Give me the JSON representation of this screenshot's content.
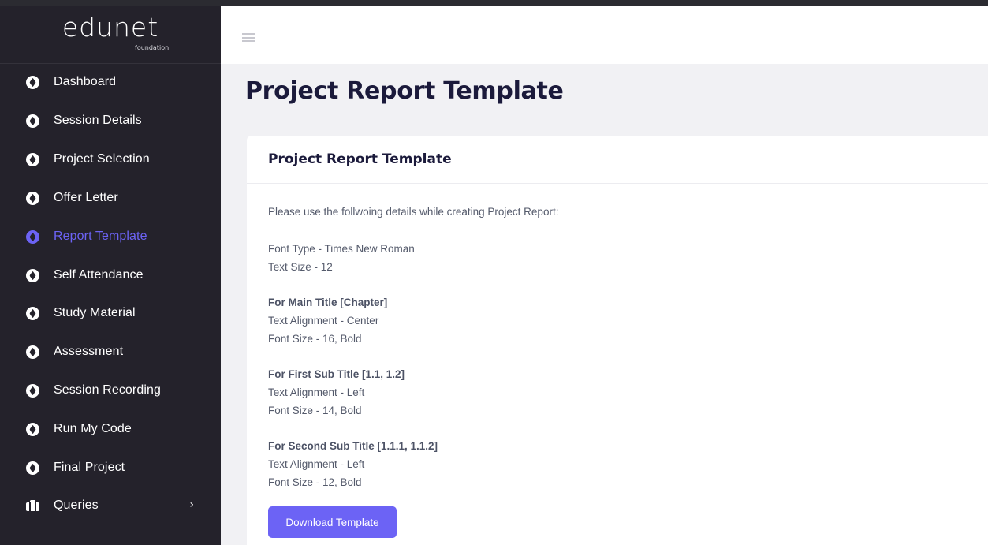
{
  "brand": {
    "name": "edunet",
    "sub": "foundation"
  },
  "sidebar": {
    "items": [
      {
        "label": "Dashboard",
        "icon": "compass-icon",
        "active": false
      },
      {
        "label": "Session Details",
        "icon": "compass-icon",
        "active": false
      },
      {
        "label": "Project Selection",
        "icon": "compass-icon",
        "active": false
      },
      {
        "label": "Offer Letter",
        "icon": "compass-icon",
        "active": false
      },
      {
        "label": "Report Template",
        "icon": "compass-icon",
        "active": true
      },
      {
        "label": "Self Attendance",
        "icon": "compass-icon",
        "active": false
      },
      {
        "label": "Study Material",
        "icon": "compass-icon",
        "active": false
      },
      {
        "label": "Assessment",
        "icon": "compass-icon",
        "active": false
      },
      {
        "label": "Session Recording",
        "icon": "compass-icon",
        "active": false
      },
      {
        "label": "Run My Code",
        "icon": "compass-icon",
        "active": false
      },
      {
        "label": "Final Project",
        "icon": "compass-icon",
        "active": false
      },
      {
        "label": "Queries",
        "icon": "briefcase-icon",
        "active": false,
        "chevron": "›"
      }
    ]
  },
  "page": {
    "title": "Project Report Template"
  },
  "card": {
    "title": "Project Report Template",
    "intro": "Please use the follwoing details while creating Project Report:",
    "font_type": "Font Type - Times New Roman",
    "text_size": "Text Size - 12",
    "main_title": {
      "heading": "For Main Title [Chapter]",
      "alignment": "Text Alignment - Center",
      "font_size": "Font Size - 16, Bold"
    },
    "first_sub": {
      "heading": "For First Sub Title [1.1, 1.2]",
      "alignment": "Text Alignment - Left",
      "font_size": "Font Size - 14, Bold"
    },
    "second_sub": {
      "heading": "For Second Sub Title [1.1.1, 1.1.2]",
      "alignment": "Text Alignment - Left",
      "font_size": "Font Size - 12, Bold"
    },
    "button_label": "Download Template"
  },
  "colors": {
    "accent": "#6c63f5",
    "sidebar_bg": "#24222b",
    "title": "#1b1a3b"
  }
}
